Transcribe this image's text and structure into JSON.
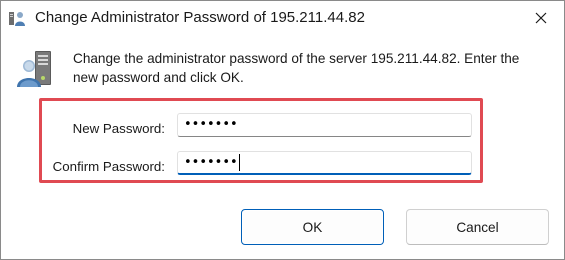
{
  "window": {
    "title": "Change Administrator Password of 195.211.44.82",
    "close_glyph": "✕"
  },
  "dialog": {
    "icon": "server-user-icon",
    "description": "Change the administrator password of the server 195.211.44.82. Enter the new password and click OK."
  },
  "form": {
    "new_password_label": "New Password:",
    "new_password_value": "•••••••",
    "confirm_password_label": "Confirm Password:",
    "confirm_password_value": "•••••••"
  },
  "buttons": {
    "ok_label": "OK",
    "cancel_label": "Cancel"
  },
  "colors": {
    "highlight_border": "#e04a52",
    "focus_accent": "#005fb8"
  }
}
